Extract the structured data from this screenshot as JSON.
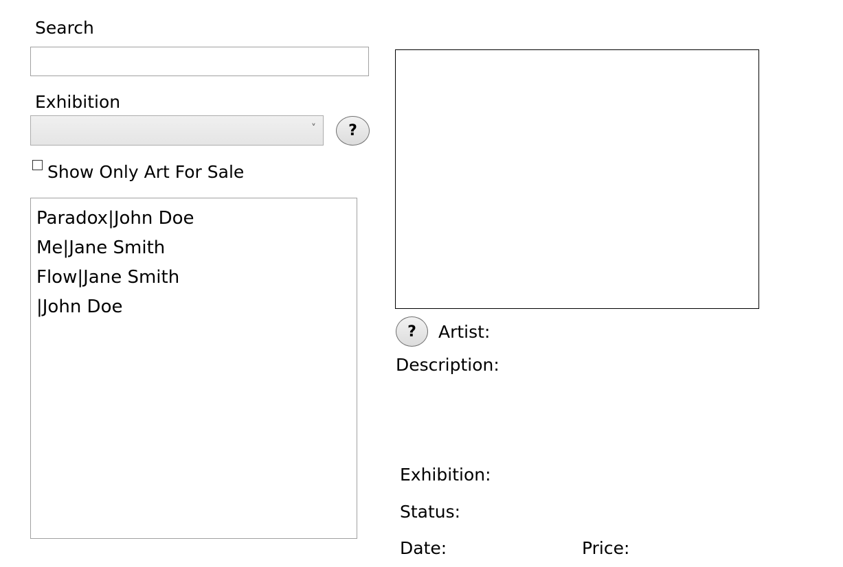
{
  "search": {
    "label": "Search",
    "value": ""
  },
  "exhibition_filter": {
    "label": "Exhibition",
    "selected": "",
    "help_label": "?"
  },
  "sale_filter": {
    "label": "Show Only Art For Sale",
    "checked": false
  },
  "art_list": {
    "items": [
      {
        "label": "Paradox|John Doe"
      },
      {
        "label": "Me|Jane Smith"
      },
      {
        "label": "Flow|Jane Smith"
      },
      {
        "label": "|John Doe"
      }
    ]
  },
  "details": {
    "help_label": "?",
    "artist_label": "Artist:",
    "description_label": "Description:",
    "exhibition_label": "Exhibition:",
    "status_label": "Status:",
    "date_label": "Date:",
    "price_label": "Price:"
  }
}
